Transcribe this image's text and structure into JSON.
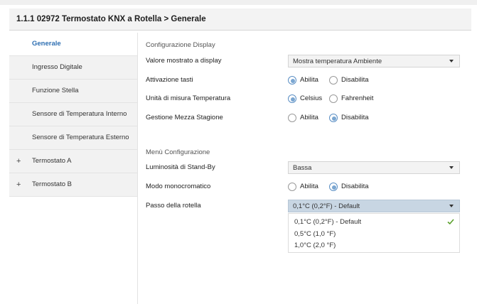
{
  "header": {
    "title": "1.1.1 02972 Termostato KNX a Rotella  > Generale"
  },
  "sidebar": {
    "items": [
      {
        "label": "Generale",
        "expandable": false,
        "active": true
      },
      {
        "label": "Ingresso Digitale",
        "expandable": false
      },
      {
        "label": "Funzione Stella",
        "expandable": false
      },
      {
        "label": "Sensore di Temperatura Interno",
        "expandable": false
      },
      {
        "label": "Sensore di Temperatura Esterno",
        "expandable": false
      },
      {
        "label": "Termostato A",
        "expandable": true
      },
      {
        "label": "Termostato B",
        "expandable": true
      }
    ],
    "expand_symbol": "+"
  },
  "display_section": {
    "title": "Configurazione Display",
    "display_value": {
      "label": "Valore mostrato a display",
      "value": "Mostra temperatura Ambiente"
    },
    "keys": {
      "label": "Attivazione tasti",
      "options": [
        "Abilita",
        "Disabilita"
      ],
      "selected": "Abilita"
    },
    "unit": {
      "label": "Unità di misura Temperatura",
      "options": [
        "Celsius",
        "Fahrenheit"
      ],
      "selected": "Celsius"
    },
    "season": {
      "label": "Gestione Mezza Stagione",
      "options": [
        "Abilita",
        "Disabilita"
      ],
      "selected": "Disabilita"
    }
  },
  "menu_section": {
    "title": "Menù Configurazione",
    "brightness": {
      "label": "Luminosità di Stand-By",
      "value": "Bassa"
    },
    "mono": {
      "label": "Modo monocromatico",
      "options": [
        "Abilita",
        "Disabilita"
      ],
      "selected": "Disabilita"
    },
    "step": {
      "label": "Passo della rotella",
      "value": "0,1°C (0,2°F) - Default",
      "options": [
        "0,1°C (0,2°F) - Default",
        "0,5°C (1,0 °F)",
        "1,0°C (2,0 °F)"
      ],
      "checked_index": 0
    }
  },
  "icons": {
    "expand": "plus-icon",
    "dropdown": "chevron-down-icon",
    "selected": "checkmark-icon"
  },
  "colors": {
    "accent": "#2e6fb2",
    "radio_selected": "#7aa6d1",
    "open_select": "#c8d6e3",
    "check": "#5aa02c"
  }
}
